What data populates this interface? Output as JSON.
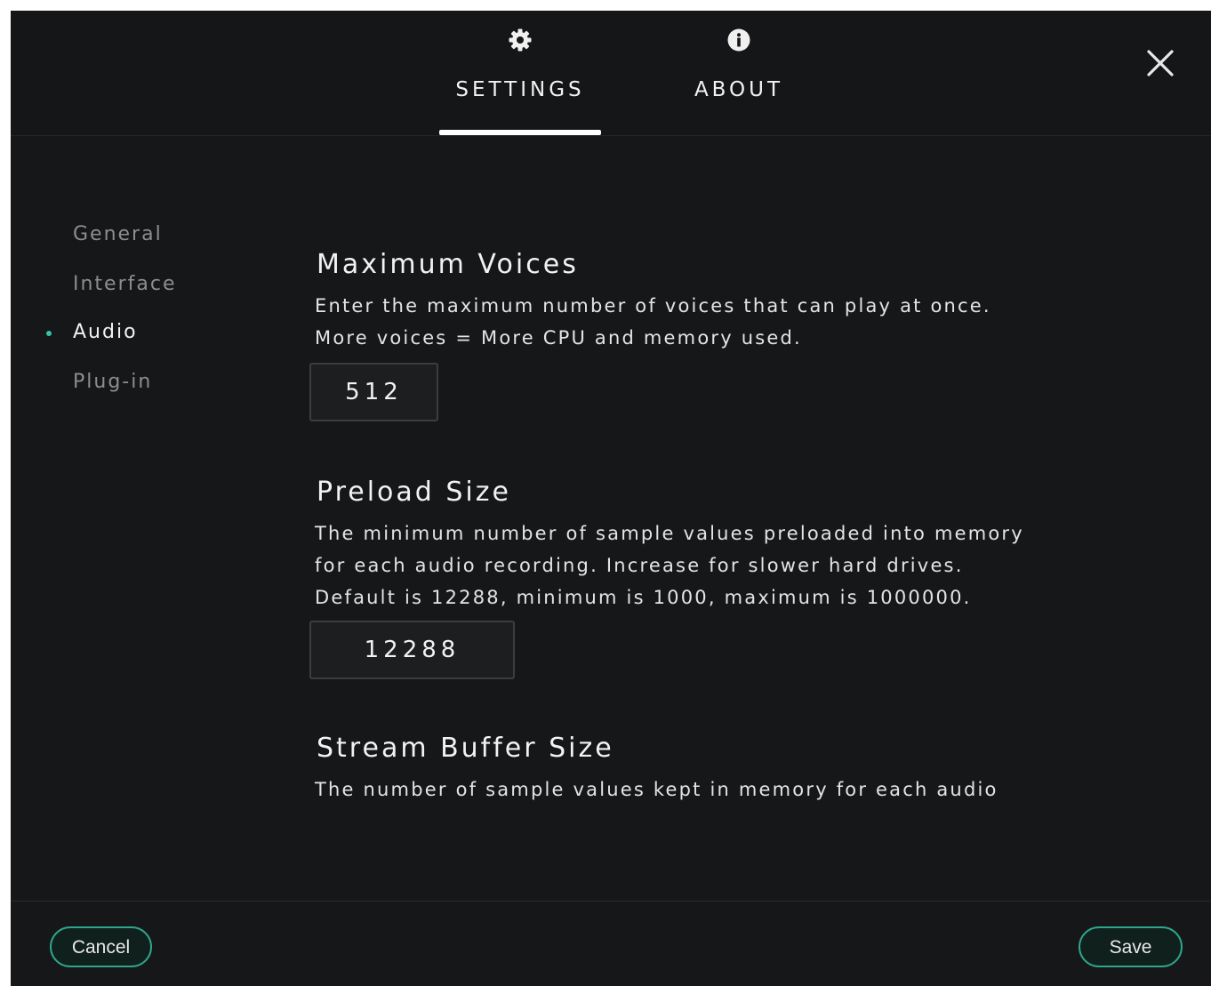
{
  "tabs": {
    "settings": {
      "label": "SETTINGS",
      "icon": "gear-icon",
      "active": true
    },
    "about": {
      "label": "ABOUT",
      "icon": "info-icon"
    }
  },
  "close_icon": "close-icon",
  "accent_color": "#35c2a6",
  "sidebar": {
    "items": [
      {
        "label": "General"
      },
      {
        "label": "Interface"
      },
      {
        "label": "Audio",
        "active": true
      },
      {
        "label": "Plug-in"
      }
    ]
  },
  "sections": {
    "max_voices": {
      "title": "Maximum Voices",
      "desc_lines": [
        "Enter the maximum number of voices that can play at once.",
        "More voices = More CPU and memory used."
      ],
      "value": "512"
    },
    "preload": {
      "title": "Preload Size",
      "desc_lines": [
        "The minimum number of sample values preloaded into memory",
        "for each audio recording. Increase for slower hard drives.",
        "Default is 12288, minimum is 1000, maximum is 1000000."
      ],
      "value": "12288"
    },
    "stream_buffer": {
      "title": "Stream Buffer Size",
      "desc_lines": [
        "The number of sample values kept in memory for each audio"
      ]
    }
  },
  "footer": {
    "cancel_label": "Cancel",
    "save_label": "Save"
  }
}
